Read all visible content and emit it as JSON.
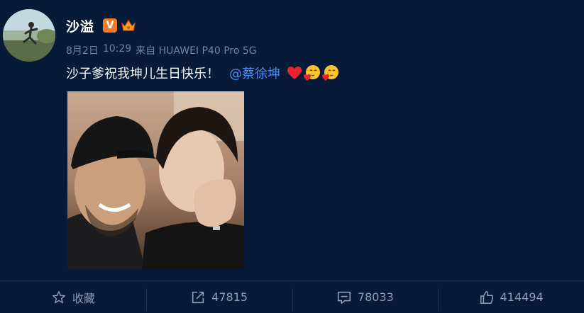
{
  "post": {
    "author": "沙溢",
    "verified_badge": "V",
    "meta": {
      "date": "8月2日",
      "time": "10:29",
      "source": "来自 HUAWEI P40 Pro 5G"
    },
    "text": "沙子爹祝我坤儿生日快乐！",
    "mention": "@蔡徐坤",
    "emojis": [
      "red-heart",
      "blushing-heart-face",
      "blushing-heart-face"
    ]
  },
  "actions": {
    "favorite_label": "收藏",
    "repost_count": "47815",
    "comment_count": "78033",
    "like_count": "414494"
  },
  "colors": {
    "background": "#071a38",
    "mention": "#4a8ff0",
    "meta": "#6f85a6",
    "action": "#8b9db8",
    "vip_badge": "#f07b2a"
  }
}
